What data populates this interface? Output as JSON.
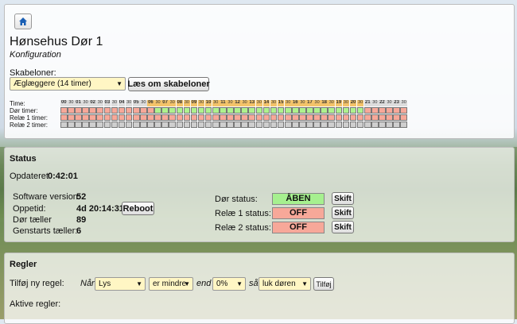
{
  "header": {
    "title": "Hønsehus Dør 1",
    "subtitle": "Konfiguration",
    "home_icon": "home-icon"
  },
  "templates": {
    "label": "Skabeloner:",
    "selected": "Æglæggere (14 timer)",
    "read_button": "Læs om skabeloner"
  },
  "schedule": {
    "labels": [
      "Time:",
      "Dør timer:",
      "Relæ 1 timer:",
      "Relæ 2 timer:"
    ],
    "hours": [
      "00",
      "30",
      "01",
      "30",
      "02",
      "30",
      "03",
      "30",
      "04",
      "30",
      "05",
      "30",
      "06",
      "30",
      "07",
      "30",
      "08",
      "30",
      "09",
      "30",
      "10",
      "30",
      "11",
      "30",
      "12",
      "30",
      "13",
      "30",
      "14",
      "30",
      "15",
      "30",
      "16",
      "30",
      "17",
      "30",
      "18",
      "30",
      "19",
      "30",
      "20",
      "30",
      "21",
      "30",
      "22",
      "30",
      "23",
      "30"
    ],
    "door_on_from": 13,
    "door_on_to": 41,
    "day_from": 12,
    "day_to": 41,
    "colors": {
      "on": "#aef28e",
      "off": "#f7a899",
      "none": "#cfcfcf"
    }
  },
  "status": {
    "heading": "Status",
    "updated_label": "Opdateret",
    "updated_value": "0:42:01",
    "software_label": "Software version:",
    "software_value": "52",
    "uptime_label": "Oppetid:",
    "uptime_value": "4d 20:14:31",
    "reboot_button": "Reboot",
    "door_counter_label": "Dør tæller",
    "door_counter_value": "89",
    "restart_counter_label": "Genstarts tæller:",
    "restart_counter_value": "6",
    "door_status_label": "Dør status:",
    "door_status_value": "ÅBEN",
    "relay1_label": "Relæ 1 status:",
    "relay1_value": "OFF",
    "relay2_label": "Relæ 2 status:",
    "relay2_value": "OFF",
    "toggle_button": "Skift",
    "colors": {
      "open": "#a6f08f",
      "off": "#f7a899"
    }
  },
  "rules": {
    "heading": "Regler",
    "add_label": "Tilføj ny regel:",
    "when": "Når",
    "sensor": "Lys",
    "comparator": "er mindre",
    "end": "end",
    "threshold": "0%",
    "then": "så",
    "action": "luk døren",
    "add_button": "Tilføj",
    "active_label": "Aktive regler:"
  }
}
